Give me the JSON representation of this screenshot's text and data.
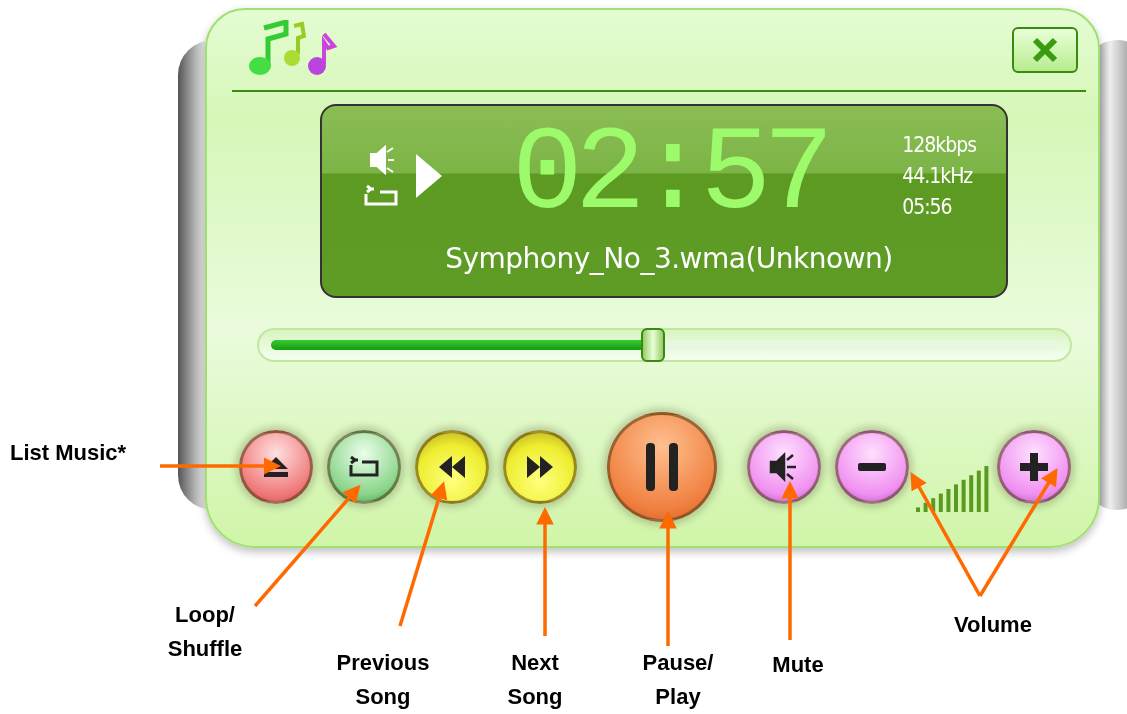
{
  "display": {
    "time": "02:57",
    "bitrate": "128kbps",
    "sample_rate": "44.1kHz",
    "duration": "05:56",
    "track": "Symphony_No_3.wma(Unknown)"
  },
  "seek_bar": {
    "level": 0.485
  },
  "controls": [
    {
      "kind": "eject"
    },
    {
      "kind": "loop"
    },
    {
      "kind": "previous"
    },
    {
      "kind": "next"
    },
    {
      "kind": "pause"
    },
    {
      "kind": "mute"
    },
    {
      "kind": "volume_down"
    },
    {
      "kind": "volume_meter"
    },
    {
      "kind": "volume_up"
    }
  ],
  "annotations": [
    {
      "text": "List Music*"
    },
    {
      "text": "Loop/ Shuffle"
    },
    {
      "text": "Previous Song"
    },
    {
      "text": "Next Song"
    },
    {
      "text": "Pause/ Play"
    },
    {
      "text": "Mute"
    },
    {
      "text": "Volume"
    }
  ]
}
